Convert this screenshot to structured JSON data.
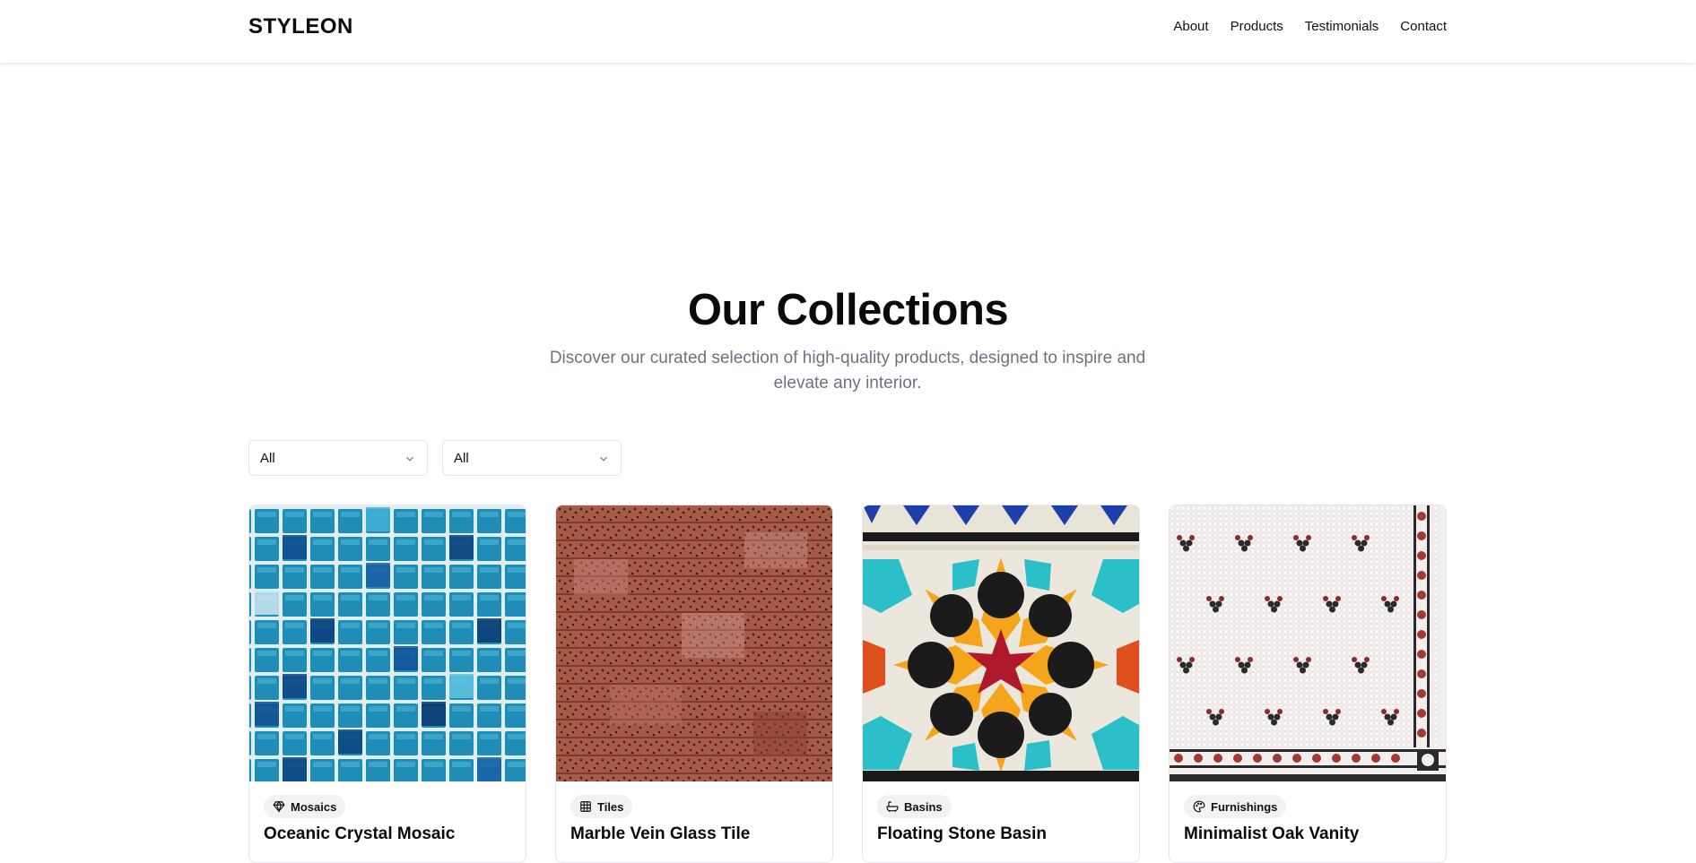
{
  "header": {
    "brand": "STYLEON",
    "nav": [
      "About",
      "Products",
      "Testimonials",
      "Contact"
    ]
  },
  "collections": {
    "title": "Our Collections",
    "subtitle": "Discover our curated selection of high-quality products, designed to inspire and elevate any interior."
  },
  "filters": [
    {
      "value": "All"
    },
    {
      "value": "All"
    }
  ],
  "products": [
    {
      "category": "Mosaics",
      "category_icon": "gem-icon",
      "title": "Oceanic Crystal Mosaic"
    },
    {
      "category": "Tiles",
      "category_icon": "grid-icon",
      "title": "Marble Vein Glass Tile"
    },
    {
      "category": "Basins",
      "category_icon": "bath-icon",
      "title": "Floating Stone Basin"
    },
    {
      "category": "Furnishings",
      "category_icon": "palette-icon",
      "title": "Minimalist Oak Vanity"
    }
  ],
  "colors": {
    "text": "#111111",
    "muted": "#6b7280",
    "border": "#e3e4e8",
    "badge_bg": "#f1f2f4"
  }
}
